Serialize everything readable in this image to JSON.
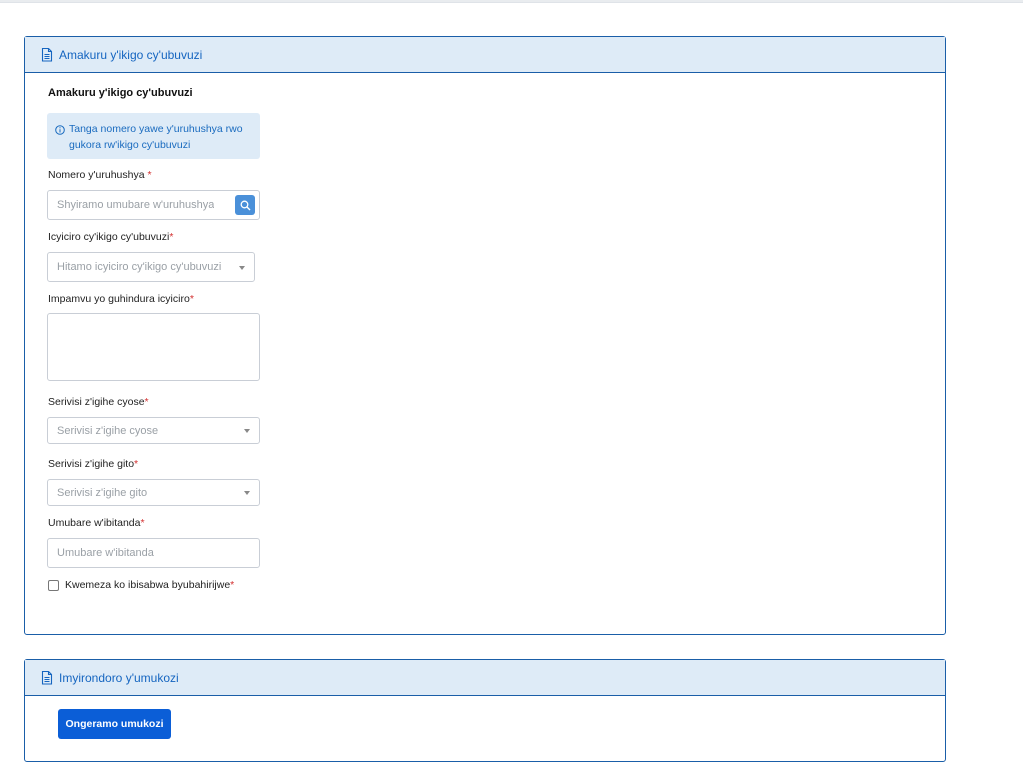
{
  "establishment_card": {
    "header_title": "Amakuru y'ikigo cy'ubuvuzi",
    "section_title": "Amakuru y'ikigo cy'ubuvuzi",
    "info_text": "Tanga nomero yawe y'uruhushya rwo gukora rw'ikigo cy'ubuvuzi",
    "license_label": "Nomero y'uruhushya",
    "license_placeholder": "Shyiramo umubare w'uruhushya",
    "category_label": "Icyiciro cy'ikigo cy'ubuvuzi",
    "category_placeholder": "Hitamo icyiciro cy'ikigo cy'ubuvuzi",
    "reason_label": "Impamvu yo guhindura icyiciro",
    "reason_value": "",
    "general_services_label": "Serivisi z'igihe cyose",
    "general_services_placeholder": "Serivisi z'igihe cyose",
    "short_services_label": "Serivisi z'igihe gito",
    "short_services_placeholder": "Serivisi z'igihe gito",
    "beds_label": "Umubare w'ibitanda",
    "beds_placeholder": "Umubare w'ibitanda",
    "confirm_label": "Kwemeza ko ibisabwa byubahirijwe",
    "confirm_checked": false,
    "required_mark": "*"
  },
  "staff_card": {
    "header_title": "Imyirondoro y'umukozi",
    "add_button_label": "Ongeramo umukozi"
  },
  "icons": {
    "header": "document-icon",
    "info": "info-icon",
    "search": "search-icon",
    "dropdown": "caret-down-icon"
  },
  "colors": {
    "accent": "#1565c0",
    "header_bg": "#deebf7",
    "primary_button": "#0b5ed7",
    "required": "#d32f2f"
  }
}
